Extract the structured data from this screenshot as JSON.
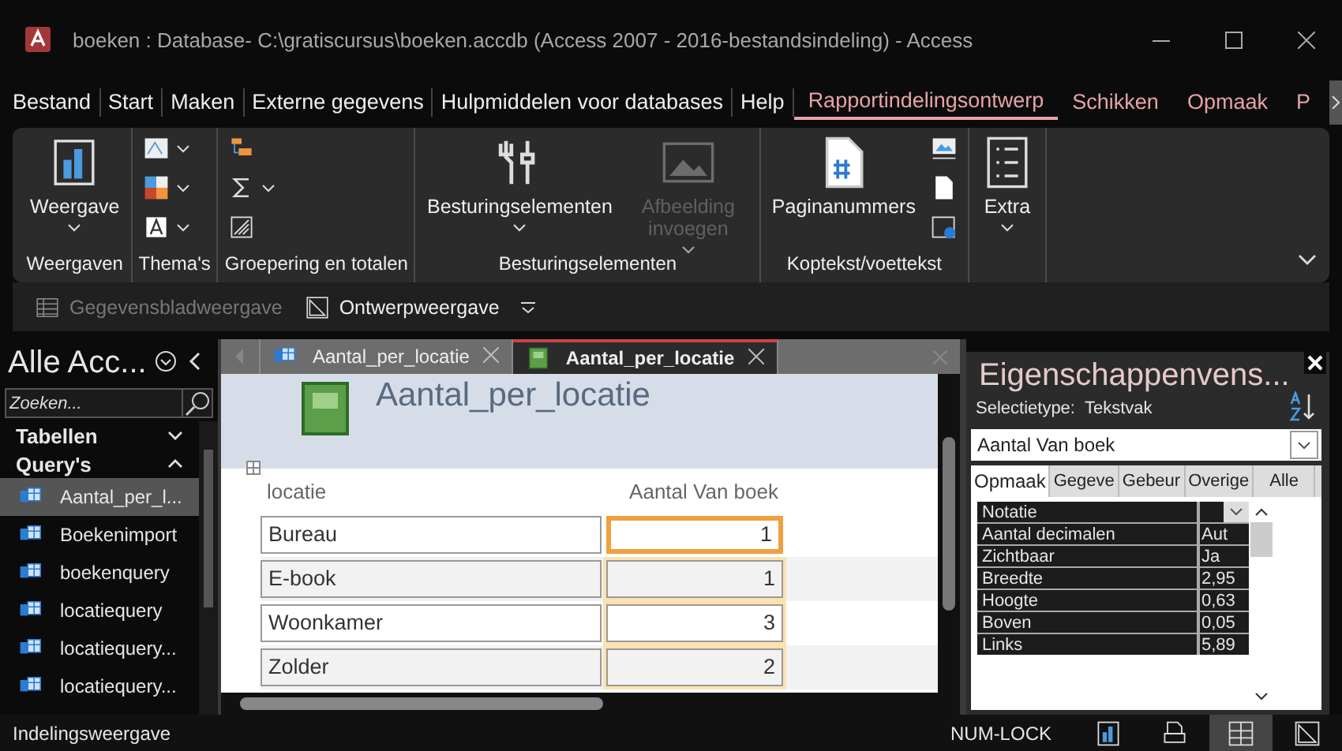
{
  "window": {
    "title": "boeken : Database- C:\\gratiscursus\\boeken.accdb (Access 2007 - 2016-bestandsindeling)  -  Access"
  },
  "menu_tabs": [
    {
      "label": "Bestand",
      "selected": false,
      "contextual": false
    },
    {
      "label": "Start",
      "selected": false,
      "contextual": false
    },
    {
      "label": "Maken",
      "selected": false,
      "contextual": false
    },
    {
      "label": "Externe gegevens",
      "selected": false,
      "contextual": false
    },
    {
      "label": "Hulpmiddelen voor databases",
      "selected": false,
      "contextual": false
    },
    {
      "label": "Help",
      "selected": false,
      "contextual": false
    },
    {
      "label": "Rapportindelingsontwerp",
      "selected": true,
      "contextual": true
    },
    {
      "label": "Schikken",
      "selected": false,
      "contextual": true
    },
    {
      "label": "Opmaak",
      "selected": false,
      "contextual": true
    },
    {
      "label": "P",
      "selected": false,
      "contextual": true
    }
  ],
  "ribbon": {
    "groups": [
      {
        "label": "Weergaven",
        "buttons": [
          {
            "kind": "large",
            "label": "Weergave",
            "dropdown": true,
            "disabled": false
          }
        ]
      },
      {
        "label": "Thema's",
        "buttons": [
          {
            "kind": "small",
            "dropdown": true
          },
          {
            "kind": "small",
            "dropdown": true
          },
          {
            "kind": "small",
            "dropdown": true
          }
        ]
      },
      {
        "label": "Groepering en totalen",
        "buttons": [
          {
            "kind": "small",
            "dropdown": false
          },
          {
            "kind": "small",
            "dropdown": true
          },
          {
            "kind": "small",
            "dropdown": false
          }
        ]
      },
      {
        "label": "Besturingselementen",
        "buttons": [
          {
            "kind": "large",
            "label": "Besturingselementen",
            "dropdown": true,
            "disabled": false
          },
          {
            "kind": "large",
            "label": "Afbeelding invoegen",
            "dropdown": true,
            "disabled": true
          }
        ]
      },
      {
        "label": "Koptekst/voettekst",
        "buttons": [
          {
            "kind": "large",
            "label": "Paginanummers",
            "dropdown": false,
            "disabled": false
          },
          {
            "kind": "small",
            "dropdown": false
          },
          {
            "kind": "small",
            "dropdown": false
          },
          {
            "kind": "small",
            "dropdown": false
          }
        ]
      },
      {
        "buttons": [
          {
            "kind": "large",
            "label": "Extra",
            "dropdown": true,
            "disabled": false
          }
        ]
      }
    ]
  },
  "quick_bar": [
    {
      "label": "Gegevensbladweergave",
      "disabled": true
    },
    {
      "label": "Ontwerpweergave",
      "disabled": false
    }
  ],
  "nav": {
    "title": "Alle Acc...",
    "search_placeholder": "Zoeken...",
    "sections": [
      {
        "label": "Tabellen",
        "expanded": false
      },
      {
        "label": "Query's",
        "expanded": true,
        "items": [
          {
            "label": "Aantal_per_l...",
            "selected": true
          },
          {
            "label": "Boekenimport",
            "selected": false
          },
          {
            "label": "boekenquery",
            "selected": false
          },
          {
            "label": "locatiequery",
            "selected": false
          },
          {
            "label": "locatiequery...",
            "selected": false
          },
          {
            "label": "locatiequery...",
            "selected": false
          }
        ]
      }
    ]
  },
  "doc_tabs": [
    {
      "label": "Aantal_per_locatie",
      "kind": "query",
      "selected": false
    },
    {
      "label": "Aantal_per_locatie",
      "kind": "report",
      "selected": true
    }
  ],
  "report": {
    "title": "Aantal_per_locatie",
    "columns": [
      "locatie",
      "Aantal Van boek"
    ],
    "rows": [
      {
        "locatie": "Bureau",
        "count": "1",
        "selected": true
      },
      {
        "locatie": "E-book",
        "count": "1",
        "selected": false
      },
      {
        "locatie": "Woonkamer",
        "count": "3",
        "selected": false
      },
      {
        "locatie": "Zolder",
        "count": "2",
        "selected": false
      }
    ]
  },
  "properties": {
    "title": "Eigenschappenvens...",
    "selection_label": "Selectietype:",
    "selection_type": "Tekstvak",
    "object": "Aantal Van boek",
    "tabs": [
      {
        "label": "Opmaak",
        "selected": true
      },
      {
        "label": "Gegeve",
        "selected": false
      },
      {
        "label": "Gebeur",
        "selected": false
      },
      {
        "label": "Overige",
        "selected": false
      },
      {
        "label": "Alle",
        "selected": false
      }
    ],
    "rows": [
      {
        "name": "Notatie",
        "kind": "dropdown"
      },
      {
        "name": "Aantal decimalen",
        "value": "Aut",
        "kind": "text"
      },
      {
        "name": "Zichtbaar",
        "value": "Ja",
        "kind": "text"
      },
      {
        "name": "Breedte",
        "value": "2,95",
        "kind": "text"
      },
      {
        "name": "Hoogte",
        "value": "0,63",
        "kind": "text"
      },
      {
        "name": "Boven",
        "value": "0,05",
        "kind": "text"
      },
      {
        "name": "Links",
        "value": "5,89",
        "kind": "text"
      }
    ]
  },
  "status_bar": {
    "text": "Indelingsweergave",
    "indicator": "NUM-LOCK",
    "views": [
      {
        "selected": false
      },
      {
        "selected": false
      },
      {
        "selected": true
      },
      {
        "selected": false
      }
    ]
  }
}
